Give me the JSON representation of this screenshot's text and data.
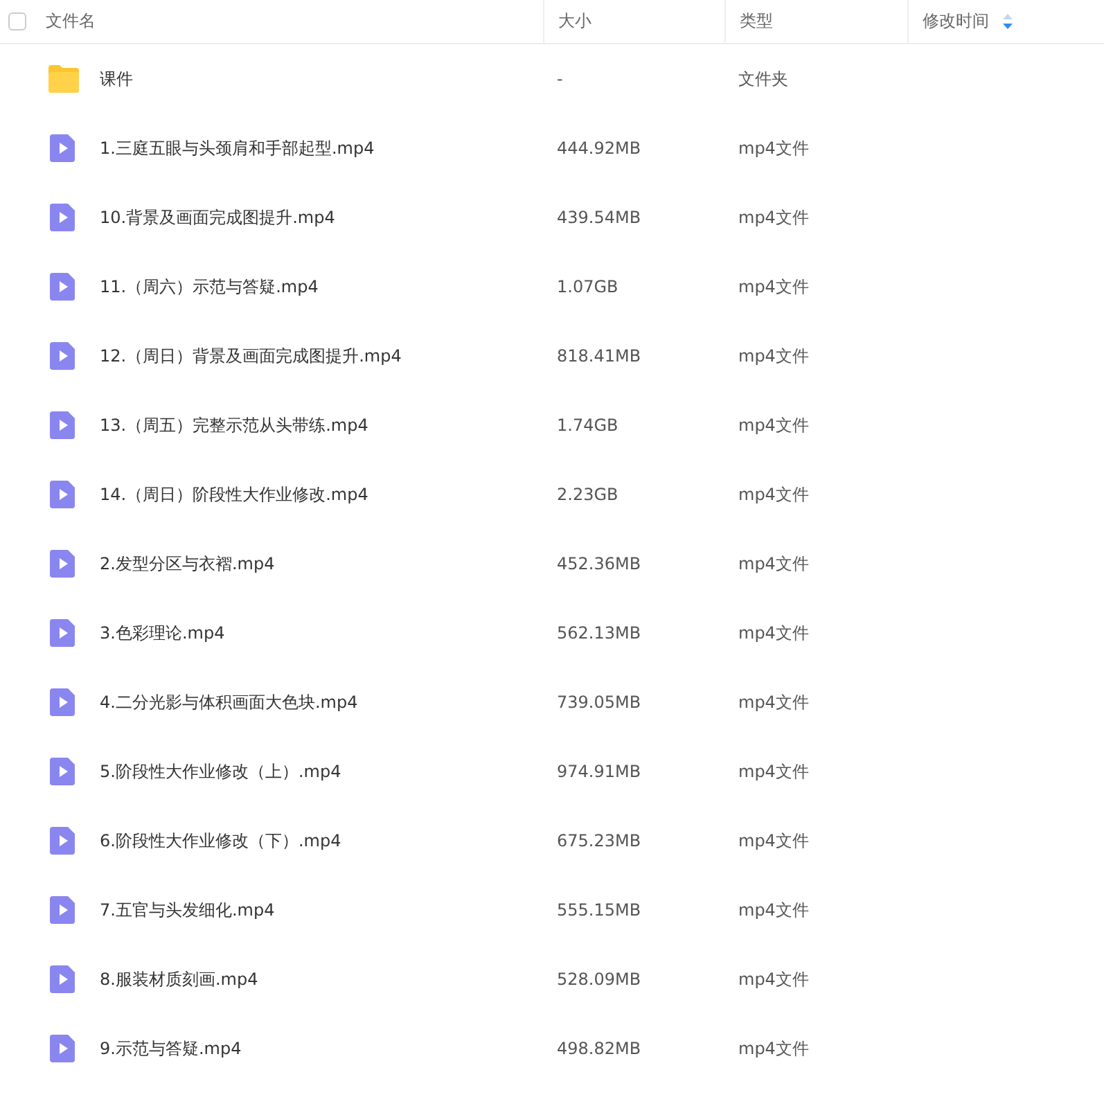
{
  "table": {
    "checked": false,
    "columns": [
      "文件名",
      "大小",
      "类型",
      "修改时间"
    ],
    "rows": [
      {
        "kind": "folder",
        "name": "课件",
        "size": "-",
        "type": "文件夹"
      },
      {
        "kind": "video",
        "name": "1.三庭五眼与头颈肩和手部起型.mp4",
        "size": "444.92MB",
        "type": "mp4文件"
      },
      {
        "kind": "video",
        "name": "10.背景及画面完成图提升.mp4",
        "size": "439.54MB",
        "type": "mp4文件"
      },
      {
        "kind": "video",
        "name": "11.（周六）示范与答疑.mp4",
        "size": "1.07GB",
        "type": "mp4文件"
      },
      {
        "kind": "video",
        "name": "12.（周日）背景及画面完成图提升.mp4",
        "size": "818.41MB",
        "type": "mp4文件"
      },
      {
        "kind": "video",
        "name": "13.（周五）完整示范从头带练.mp4",
        "size": "1.74GB",
        "type": "mp4文件"
      },
      {
        "kind": "video",
        "name": "14.（周日）阶段性大作业修改.mp4",
        "size": "2.23GB",
        "type": "mp4文件"
      },
      {
        "kind": "video",
        "name": "2.发型分区与衣褶.mp4",
        "size": "452.36MB",
        "type": "mp4文件"
      },
      {
        "kind": "video",
        "name": "3.色彩理论.mp4",
        "size": "562.13MB",
        "type": "mp4文件"
      },
      {
        "kind": "video",
        "name": "4.二分光影与体积画面大色块.mp4",
        "size": "739.05MB",
        "type": "mp4文件"
      },
      {
        "kind": "video",
        "name": "5.阶段性大作业修改（上）.mp4",
        "size": "974.91MB",
        "type": "mp4文件"
      },
      {
        "kind": "video",
        "name": "6.阶段性大作业修改（下）.mp4",
        "size": "675.23MB",
        "type": "mp4文件"
      },
      {
        "kind": "video",
        "name": "7.五官与头发细化.mp4",
        "size": "555.15MB",
        "type": "mp4文件"
      },
      {
        "kind": "video",
        "name": "8.服装材质刻画.mp4",
        "size": "528.09MB",
        "type": "mp4文件"
      },
      {
        "kind": "video",
        "name": "9.示范与答疑.mp4",
        "size": "498.82MB",
        "type": "mp4文件"
      }
    ]
  }
}
